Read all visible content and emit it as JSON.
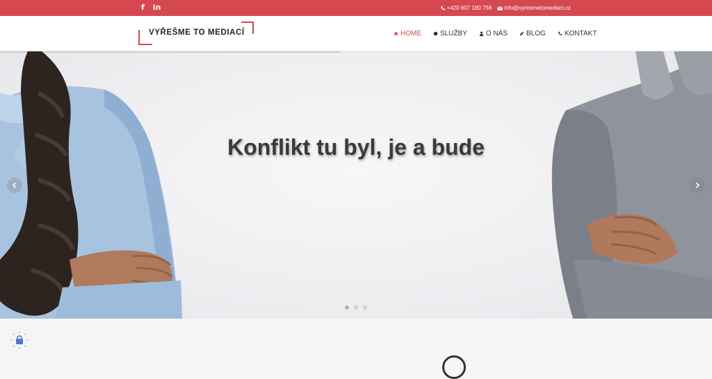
{
  "topbar": {
    "social": [
      {
        "icon": "facebook-icon",
        "glyph": "f"
      },
      {
        "icon": "linkedin-icon",
        "glyph": "in"
      }
    ],
    "phone": "+420 607 190 756",
    "email": "info@vyresmetomediaci.cz"
  },
  "header": {
    "logo_text": "VYŘEŠME TO MEDIACÍ",
    "nav": [
      {
        "label": "HOME",
        "icon": "home-icon",
        "active": true
      },
      {
        "label": "SLUŽBY",
        "icon": "circle-icon",
        "active": false
      },
      {
        "label": "O NÁS",
        "icon": "user-icon",
        "active": false
      },
      {
        "label": "BLOG",
        "icon": "pencil-icon",
        "active": false
      },
      {
        "label": "KONTAKT",
        "icon": "phone-icon",
        "active": false
      }
    ],
    "accent_color": "#d5484f"
  },
  "hero": {
    "title": "Konflikt tu byl, je a bude",
    "slides": 3,
    "active_slide": 1,
    "prev_icon": "chevron-left-icon",
    "next_icon": "chevron-right-icon"
  }
}
